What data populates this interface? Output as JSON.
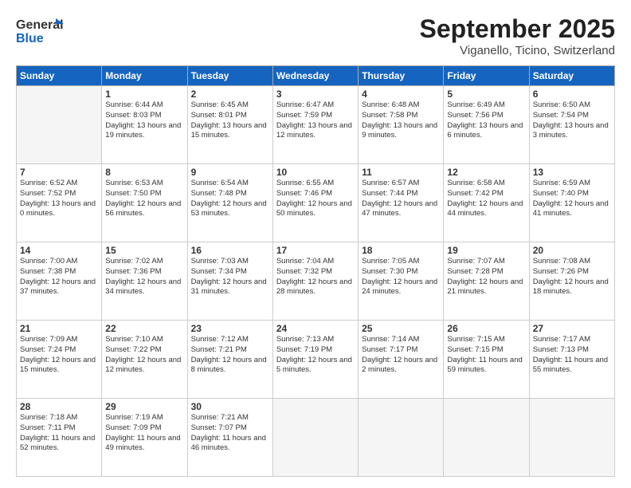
{
  "header": {
    "title": "September 2025",
    "location": "Viganello, Ticino, Switzerland",
    "logo_general": "General",
    "logo_blue": "Blue"
  },
  "weekdays": [
    "Sunday",
    "Monday",
    "Tuesday",
    "Wednesday",
    "Thursday",
    "Friday",
    "Saturday"
  ],
  "weeks": [
    [
      {
        "day": "",
        "info": ""
      },
      {
        "day": "1",
        "info": "Sunrise: 6:44 AM\nSunset: 8:03 PM\nDaylight: 13 hours\nand 19 minutes."
      },
      {
        "day": "2",
        "info": "Sunrise: 6:45 AM\nSunset: 8:01 PM\nDaylight: 13 hours\nand 15 minutes."
      },
      {
        "day": "3",
        "info": "Sunrise: 6:47 AM\nSunset: 7:59 PM\nDaylight: 13 hours\nand 12 minutes."
      },
      {
        "day": "4",
        "info": "Sunrise: 6:48 AM\nSunset: 7:58 PM\nDaylight: 13 hours\nand 9 minutes."
      },
      {
        "day": "5",
        "info": "Sunrise: 6:49 AM\nSunset: 7:56 PM\nDaylight: 13 hours\nand 6 minutes."
      },
      {
        "day": "6",
        "info": "Sunrise: 6:50 AM\nSunset: 7:54 PM\nDaylight: 13 hours\nand 3 minutes."
      }
    ],
    [
      {
        "day": "7",
        "info": "Sunrise: 6:52 AM\nSunset: 7:52 PM\nDaylight: 13 hours\nand 0 minutes."
      },
      {
        "day": "8",
        "info": "Sunrise: 6:53 AM\nSunset: 7:50 PM\nDaylight: 12 hours\nand 56 minutes."
      },
      {
        "day": "9",
        "info": "Sunrise: 6:54 AM\nSunset: 7:48 PM\nDaylight: 12 hours\nand 53 minutes."
      },
      {
        "day": "10",
        "info": "Sunrise: 6:55 AM\nSunset: 7:46 PM\nDaylight: 12 hours\nand 50 minutes."
      },
      {
        "day": "11",
        "info": "Sunrise: 6:57 AM\nSunset: 7:44 PM\nDaylight: 12 hours\nand 47 minutes."
      },
      {
        "day": "12",
        "info": "Sunrise: 6:58 AM\nSunset: 7:42 PM\nDaylight: 12 hours\nand 44 minutes."
      },
      {
        "day": "13",
        "info": "Sunrise: 6:59 AM\nSunset: 7:40 PM\nDaylight: 12 hours\nand 41 minutes."
      }
    ],
    [
      {
        "day": "14",
        "info": "Sunrise: 7:00 AM\nSunset: 7:38 PM\nDaylight: 12 hours\nand 37 minutes."
      },
      {
        "day": "15",
        "info": "Sunrise: 7:02 AM\nSunset: 7:36 PM\nDaylight: 12 hours\nand 34 minutes."
      },
      {
        "day": "16",
        "info": "Sunrise: 7:03 AM\nSunset: 7:34 PM\nDaylight: 12 hours\nand 31 minutes."
      },
      {
        "day": "17",
        "info": "Sunrise: 7:04 AM\nSunset: 7:32 PM\nDaylight: 12 hours\nand 28 minutes."
      },
      {
        "day": "18",
        "info": "Sunrise: 7:05 AM\nSunset: 7:30 PM\nDaylight: 12 hours\nand 24 minutes."
      },
      {
        "day": "19",
        "info": "Sunrise: 7:07 AM\nSunset: 7:28 PM\nDaylight: 12 hours\nand 21 minutes."
      },
      {
        "day": "20",
        "info": "Sunrise: 7:08 AM\nSunset: 7:26 PM\nDaylight: 12 hours\nand 18 minutes."
      }
    ],
    [
      {
        "day": "21",
        "info": "Sunrise: 7:09 AM\nSunset: 7:24 PM\nDaylight: 12 hours\nand 15 minutes."
      },
      {
        "day": "22",
        "info": "Sunrise: 7:10 AM\nSunset: 7:22 PM\nDaylight: 12 hours\nand 12 minutes."
      },
      {
        "day": "23",
        "info": "Sunrise: 7:12 AM\nSunset: 7:21 PM\nDaylight: 12 hours\nand 8 minutes."
      },
      {
        "day": "24",
        "info": "Sunrise: 7:13 AM\nSunset: 7:19 PM\nDaylight: 12 hours\nand 5 minutes."
      },
      {
        "day": "25",
        "info": "Sunrise: 7:14 AM\nSunset: 7:17 PM\nDaylight: 12 hours\nand 2 minutes."
      },
      {
        "day": "26",
        "info": "Sunrise: 7:15 AM\nSunset: 7:15 PM\nDaylight: 11 hours\nand 59 minutes."
      },
      {
        "day": "27",
        "info": "Sunrise: 7:17 AM\nSunset: 7:13 PM\nDaylight: 11 hours\nand 55 minutes."
      }
    ],
    [
      {
        "day": "28",
        "info": "Sunrise: 7:18 AM\nSunset: 7:11 PM\nDaylight: 11 hours\nand 52 minutes."
      },
      {
        "day": "29",
        "info": "Sunrise: 7:19 AM\nSunset: 7:09 PM\nDaylight: 11 hours\nand 49 minutes."
      },
      {
        "day": "30",
        "info": "Sunrise: 7:21 AM\nSunset: 7:07 PM\nDaylight: 11 hours\nand 46 minutes."
      },
      {
        "day": "",
        "info": ""
      },
      {
        "day": "",
        "info": ""
      },
      {
        "day": "",
        "info": ""
      },
      {
        "day": "",
        "info": ""
      }
    ]
  ]
}
